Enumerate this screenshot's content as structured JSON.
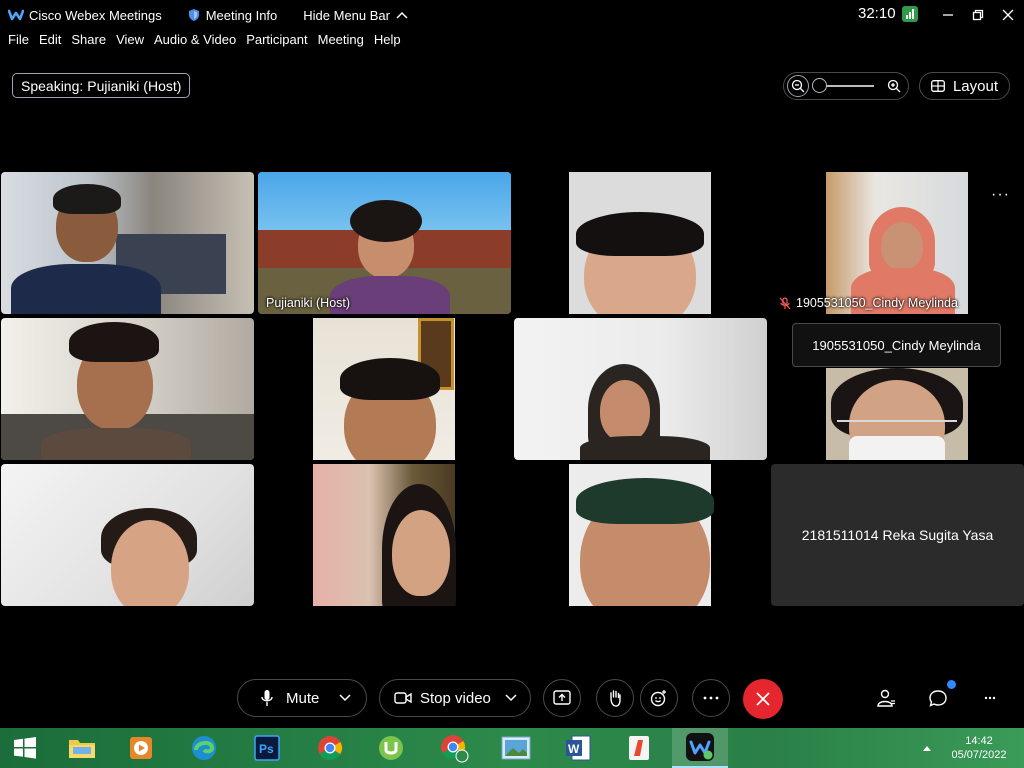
{
  "titlebar": {
    "app_name": "Cisco Webex Meetings",
    "meeting_info": "Meeting Info",
    "hide_menu": "Hide Menu Bar",
    "timer": "32:10"
  },
  "menu": [
    "File",
    "Edit",
    "Share",
    "View",
    "Audio & Video",
    "Participant",
    "Meeting",
    "Help"
  ],
  "speaking": {
    "prefix": "Speaking:",
    "name": "Pujianiki (Host)"
  },
  "layout_label": "Layout",
  "tiles": {
    "host_label": "Pujianiki (Host)",
    "cindy_label": "1905531050_Cindy Meylinda",
    "tooltip": "1905531050_Cindy Meylinda",
    "reka_label": "2181511014 Reka Sugita Yasa"
  },
  "controls": {
    "mute": "Mute",
    "stop_video": "Stop video"
  },
  "taskbar": {
    "time": "14:42",
    "date": "05/07/2022"
  },
  "colors": {
    "end_call": "#e5262f",
    "active_border": "#5aa8ff",
    "taskbar": "#2c8a4b"
  }
}
